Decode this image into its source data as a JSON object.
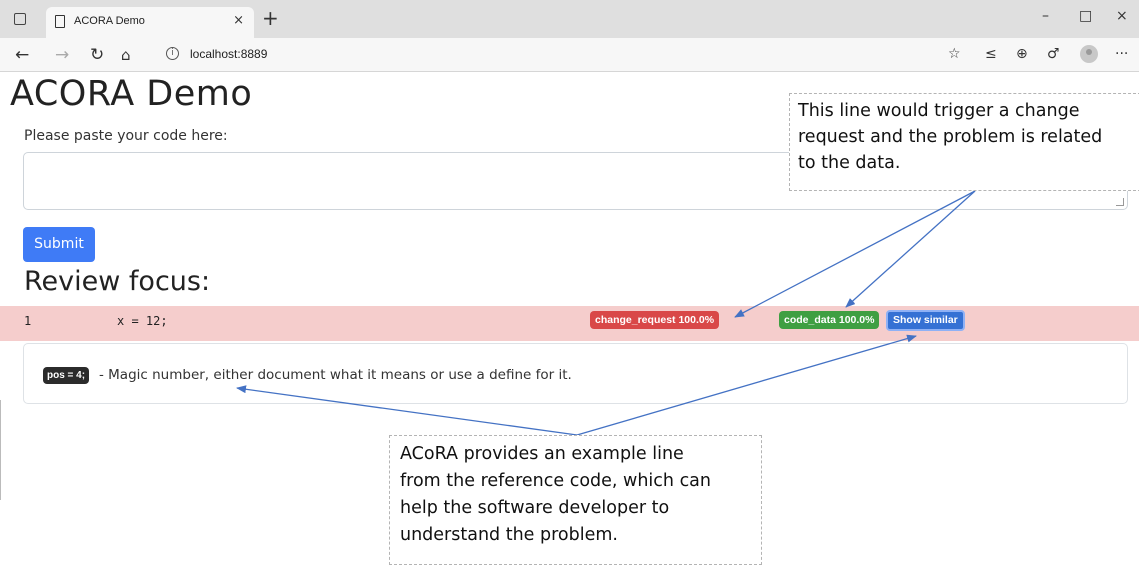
{
  "browser": {
    "tab_title": "ACORA Demo",
    "tab_close": "×",
    "new_tab": "+",
    "url": "localhost:8889",
    "window_controls": {
      "minimize": "–",
      "maximize": "□",
      "close": "×"
    },
    "icons": [
      "tab-actions-icon",
      "page-icon",
      "back-icon",
      "forward-icon",
      "reload-icon",
      "home-icon",
      "info-icon",
      "read-aloud-icon",
      "favorites-icon",
      "collections-icon",
      "extensions-icon",
      "profile-icon",
      "more-icon"
    ]
  },
  "page": {
    "title": "ACORA Demo",
    "prompt": "Please paste your code here:",
    "code_input_value": "",
    "submit_label": "Submit",
    "review_title": "Review focus:",
    "result_row": {
      "line_number": "1",
      "code": "x = 12;",
      "badges": {
        "change_request": "change_request 100.0%",
        "code_data": "code_data 100.0%",
        "show_similar": "Show similar"
      }
    },
    "similar": {
      "pos": "pos = 4;",
      "text": "- Magic number, either document what it means or use a define for it."
    }
  },
  "annotations": {
    "callout_top": [
      "This line would trigger a change",
      "request and the problem is related",
      "to the data."
    ],
    "callout_bottom": [
      "ACoRA provides an example line",
      "from the reference code, which can",
      "help the software developer to",
      "understand the problem."
    ]
  },
  "colors": {
    "row_highlight": "#f5cdcc",
    "badge_change_request": "#d94848",
    "badge_code_data": "#3f9f42",
    "badge_show_similar": "#3571d4",
    "submit": "#3f7bf6",
    "arrow": "#4472c4"
  }
}
